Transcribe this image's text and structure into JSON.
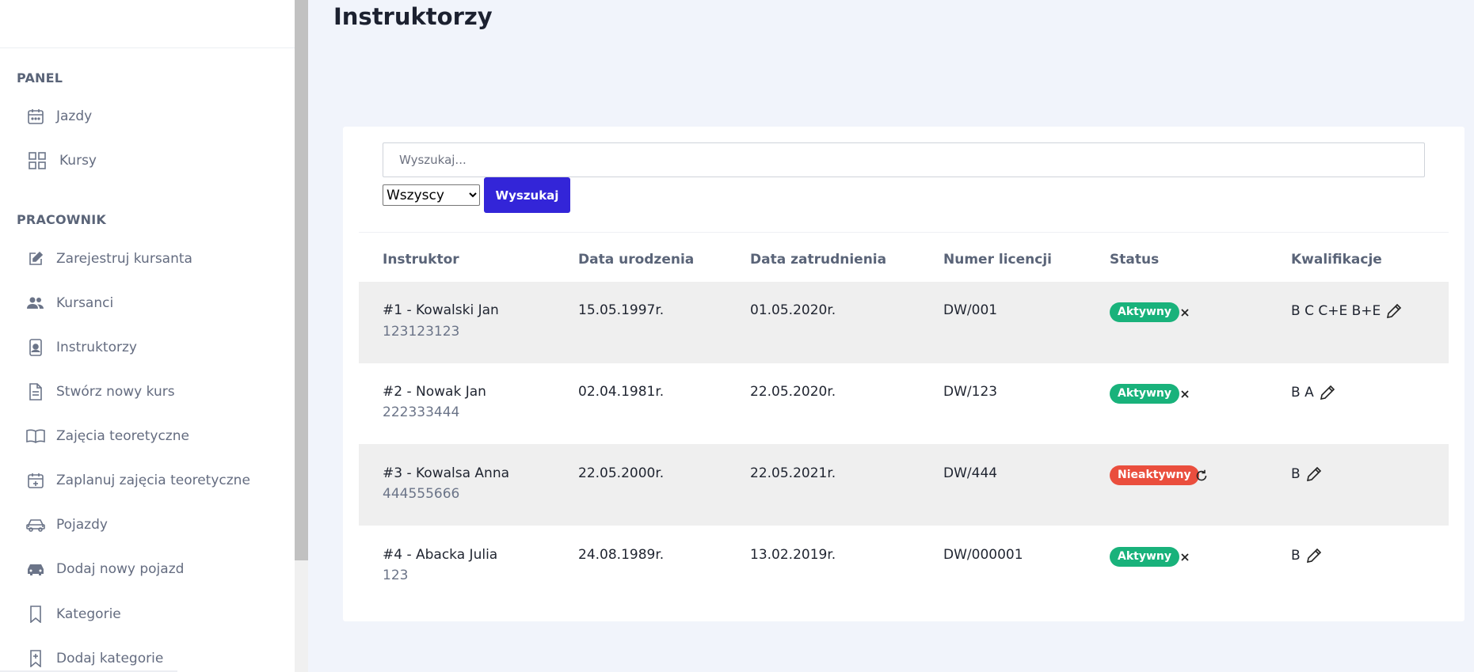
{
  "page": {
    "title": "Instruktorzy"
  },
  "sidebar": {
    "sections": [
      {
        "label": "PANEL",
        "items": [
          {
            "label": "Jazdy",
            "icon": "calendar-icon"
          },
          {
            "label": "Kursy",
            "icon": "grid-icon"
          }
        ]
      },
      {
        "label": "PRACOWNIK",
        "items": [
          {
            "label": "Zarejestruj kursanta",
            "icon": "edit-icon"
          },
          {
            "label": "Kursanci",
            "icon": "users-icon"
          },
          {
            "label": "Instruktorzy",
            "icon": "badge-icon"
          },
          {
            "label": "Stwórz nowy kurs",
            "icon": "document-icon"
          },
          {
            "label": "Zajęcia teoretyczne",
            "icon": "book-icon"
          },
          {
            "label": "Zaplanuj zajęcia teoretyczne",
            "icon": "calendar-plus-icon"
          },
          {
            "label": "Pojazdy",
            "icon": "car-icon"
          },
          {
            "label": "Dodaj nowy pojazd",
            "icon": "car-filled-icon"
          },
          {
            "label": "Kategorie",
            "icon": "bookmark-icon"
          },
          {
            "label": "Dodaj kategorie",
            "icon": "bookmark-plus-icon"
          }
        ]
      }
    ]
  },
  "search": {
    "placeholder": "Wyszukaj...",
    "value": "",
    "button_label": "Wyszukaj"
  },
  "filter": {
    "selected": "Wszyscy",
    "options": [
      "Wszyscy"
    ]
  },
  "table": {
    "headers": [
      "Instruktor",
      "Data urodzenia",
      "Data zatrudnienia",
      "Numer licencji",
      "Status",
      "Kwalifikacje"
    ],
    "rows": [
      {
        "name": "#1 - Kowalski Jan",
        "phone": "123123123",
        "birth": "15.05.1997r.",
        "hired": "01.05.2020r.",
        "license": "DW/001",
        "status": "Aktywny",
        "status_type": "active",
        "action_icon": "close-icon",
        "qualifications": "B C C+E B+E"
      },
      {
        "name": "#2 - Nowak Jan",
        "phone": "222333444",
        "birth": "02.04.1981r.",
        "hired": "22.05.2020r.",
        "license": "DW/123",
        "status": "Aktywny",
        "status_type": "active",
        "action_icon": "close-icon",
        "qualifications": "B A"
      },
      {
        "name": "#3 - Kowalsa Anna",
        "phone": "444555666",
        "birth": "22.05.2000r.",
        "hired": "22.05.2021r.",
        "license": "DW/444",
        "status": "Nieaktywny",
        "status_type": "inactive",
        "action_icon": "refresh-icon",
        "qualifications": "B"
      },
      {
        "name": "#4 - Abacka Julia",
        "phone": "123",
        "birth": "24.08.1989r.",
        "hired": "13.02.2019r.",
        "license": "DW/000001",
        "status": "Aktywny",
        "status_type": "active",
        "action_icon": "close-icon",
        "qualifications": "B"
      }
    ]
  },
  "colors": {
    "accent": "#3325d8",
    "active": "#19b27b",
    "inactive": "#ea4e3d",
    "background": "#f1f4fb"
  }
}
